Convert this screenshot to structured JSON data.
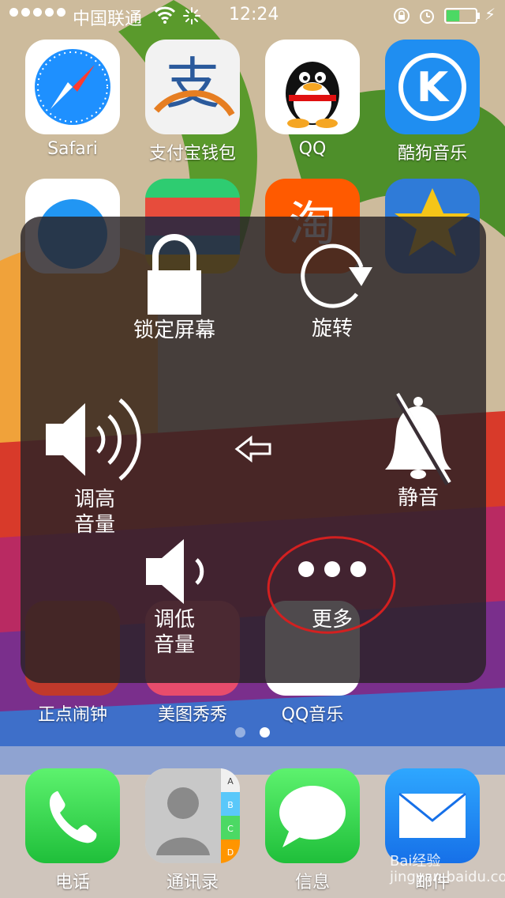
{
  "status_bar": {
    "carrier": "中国联通",
    "time": "12:24",
    "signal_dots": 5,
    "battery_level_pct": 45,
    "battery_color": "#4cd964"
  },
  "home_screen": {
    "row1": [
      {
        "label": "Safari",
        "icon": "safari-compass-icon"
      },
      {
        "label": "支付宝钱包",
        "icon": "alipay-icon"
      },
      {
        "label": "QQ",
        "icon": "qq-penguin-icon"
      },
      {
        "label": "酷狗音乐",
        "icon": "kugou-icon"
      }
    ],
    "row3": [
      {
        "label": "正点闹钟",
        "icon": "alarm-app-icon"
      },
      {
        "label": "美图秀秀",
        "icon": "meitu-icon"
      },
      {
        "label": "QQ音乐",
        "icon": "qq-music-icon"
      }
    ],
    "page_count": 2,
    "active_page": 2
  },
  "dock": [
    {
      "label": "电话",
      "icon": "phone-icon"
    },
    {
      "label": "通讯录",
      "icon": "contacts-icon",
      "tabs": [
        "A",
        "B",
        "C",
        "D"
      ]
    },
    {
      "label": "信息",
      "icon": "messages-icon"
    },
    {
      "label": "邮件",
      "icon": "mail-icon"
    }
  ],
  "assistive_touch": {
    "lock_label": "锁定屏幕",
    "rotate_label": "旋转",
    "volume_up_label_1": "调高",
    "volume_up_label_2": "音量",
    "mute_label": "静音",
    "volume_down_label_1": "调低",
    "volume_down_label_2": "音量",
    "more_label": "更多"
  },
  "watermark": "Bai经验 jingyan.baidu.com"
}
